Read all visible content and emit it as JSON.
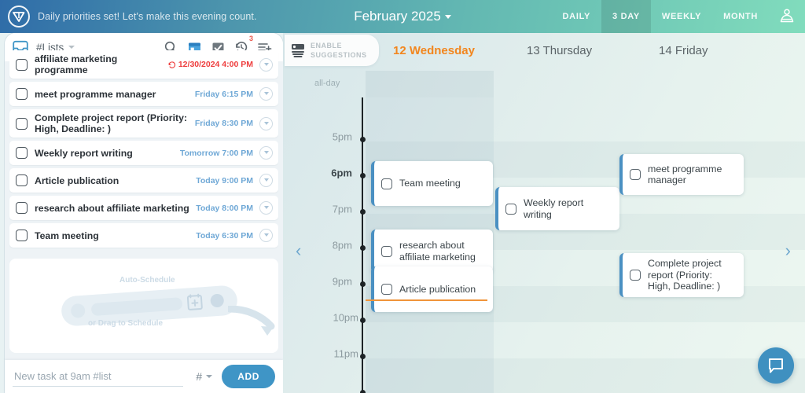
{
  "header": {
    "logo_icon": "vimcal-logo-icon",
    "greeting": "Daily priorities set! Let's make this evening count.",
    "month_title": "February 2025",
    "views": [
      {
        "label": "DAILY",
        "active": false
      },
      {
        "label": "3 DAY",
        "active": true
      },
      {
        "label": "WEEKLY",
        "active": false
      },
      {
        "label": "MONTH",
        "active": false
      }
    ],
    "avatar_icon": "person-avatar-icon"
  },
  "sidebar": {
    "list_icon": "inbox-list-icon",
    "list_label": "#Lists",
    "toolbar": [
      {
        "name": "search-icon",
        "badge": ""
      },
      {
        "name": "calendar-icon",
        "badge": ""
      },
      {
        "name": "checkbox-icon",
        "badge": ""
      },
      {
        "name": "history-icon",
        "badge": "3"
      },
      {
        "name": "add-list-icon",
        "badge": ""
      }
    ],
    "tasks": [
      {
        "title": "affiliate marketing programme",
        "date": "12/30/2024 4:00 PM",
        "overdue": true
      },
      {
        "title": "meet programme manager",
        "date": "Friday 6:15 PM",
        "overdue": false
      },
      {
        "title": "Complete project report (Priority: High, Deadline: )",
        "date": "Friday 8:30 PM",
        "overdue": false
      },
      {
        "title": "Weekly report writing",
        "date": "Tomorrow 7:00 PM",
        "overdue": false
      },
      {
        "title": "Article publication",
        "date": "Today 9:00 PM",
        "overdue": false
      },
      {
        "title": "research about affiliate marketing",
        "date": "Today 8:00 PM",
        "overdue": false
      },
      {
        "title": "Team meeting",
        "date": "Today 6:30 PM",
        "overdue": false
      }
    ],
    "illustration": {
      "auto_label": "Auto-Schedule",
      "drag_label": "or Drag to Schedule"
    },
    "add_bar": {
      "placeholder": "New task at 9am #list",
      "value": "",
      "hash_label": "#",
      "add_label": "ADD"
    }
  },
  "calendar": {
    "suggest_button": {
      "icon": "suggestions-icon",
      "line1": "ENABLE",
      "line2": "SUGGESTIONS"
    },
    "allday_label": "all-day",
    "days": [
      {
        "label": "12 Wednesday",
        "today": true
      },
      {
        "label": "13 Thursday",
        "today": false
      },
      {
        "label": "14 Friday",
        "today": false
      }
    ],
    "hours": [
      "5pm",
      "6pm",
      "7pm",
      "8pm",
      "9pm",
      "10pm",
      "11pm"
    ],
    "current_hour": "6pm",
    "events": [
      {
        "title": "Team meeting",
        "day": 0,
        "start": "6:30pm",
        "end": "7:30pm"
      },
      {
        "title": "research about affiliate marketing",
        "day": 0,
        "start": "8:00pm",
        "end": "9:00pm"
      },
      {
        "title": "Article publication",
        "day": 0,
        "start": "9:00pm",
        "end": "10:00pm"
      },
      {
        "title": "Weekly report writing",
        "day": 1,
        "start": "7:00pm",
        "end": "8:00pm"
      },
      {
        "title": "meet programme manager",
        "day": 2,
        "start": "6:15pm",
        "end": "7:15pm"
      },
      {
        "title": "Complete project report (Priority: High, Deadline: )",
        "day": 2,
        "start": "8:30pm",
        "end": "9:30pm"
      }
    ],
    "prev_icon": "chevron-left-icon",
    "next_icon": "chevron-right-icon",
    "chat_icon": "chat-bubble-icon",
    "now_marker_color": "#f0943a",
    "today_color": "#f2861e",
    "event_accent_color": "#4a90c2"
  }
}
